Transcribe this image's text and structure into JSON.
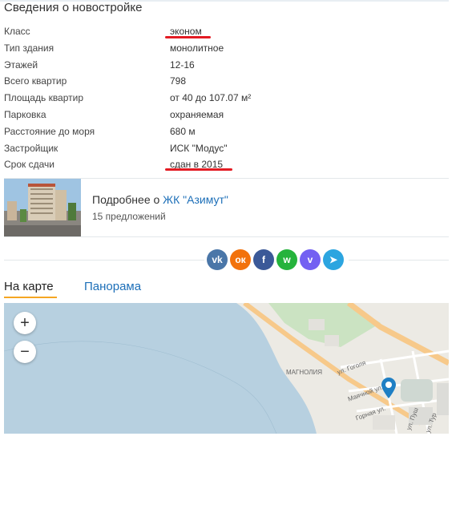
{
  "section_title": "Сведения о новостройке",
  "specs": [
    {
      "label": "Класс",
      "value": "эконом"
    },
    {
      "label": "Тип здания",
      "value": "монолитное"
    },
    {
      "label": "Этажей",
      "value": "12-16"
    },
    {
      "label": "Всего квартир",
      "value": "798"
    },
    {
      "label": "Площадь квартир",
      "value": "от 40 до 107.07 м²"
    },
    {
      "label": "Парковка",
      "value": "охраняемая"
    },
    {
      "label": "Расстояние до моря",
      "value": "680 м"
    },
    {
      "label": "Застройщик",
      "value": "ИСК \"Модус\""
    },
    {
      "label": "Срок сдачи",
      "value": "сдан в 2015"
    }
  ],
  "complex_card": {
    "prefix": "Подробнее о ",
    "link": "ЖК \"Азимут\"",
    "offers": "15 предложений"
  },
  "social_icons": [
    {
      "name": "vk-icon",
      "text": "vk",
      "color": "#4a76a8"
    },
    {
      "name": "odnoklassniki-icon",
      "text": "ок",
      "color": "#f2720c"
    },
    {
      "name": "facebook-icon",
      "text": "f",
      "color": "#3b5998"
    },
    {
      "name": "whatsapp-icon",
      "text": "w",
      "color": "#25b33c"
    },
    {
      "name": "viber-icon",
      "text": "v",
      "color": "#7360f2"
    },
    {
      "name": "telegram-icon",
      "text": "➤",
      "color": "#2ca5e0"
    }
  ],
  "tabs": {
    "map": "На карте",
    "panorama": "Панорама"
  },
  "map": {
    "zoom_in": "+",
    "zoom_out": "−",
    "labels": {
      "district": "МАГНОЛИЯ",
      "street_gogolya": "ул. Гоголя",
      "street_mayachnaya": "Маячной ул.",
      "street_gornaya": "Горная ул.",
      "street_push": "ул. Пуш",
      "street_tur": "ул. Тур"
    }
  },
  "colors": {
    "accent_link": "#1d6fb8",
    "underline_red": "#e31b23",
    "tab_active": "#f5a623",
    "water": "#b7d0e0",
    "land": "#eceae4",
    "road": "#f7c98a",
    "park": "#cbe3c2",
    "marker": "#1f7fc4"
  }
}
